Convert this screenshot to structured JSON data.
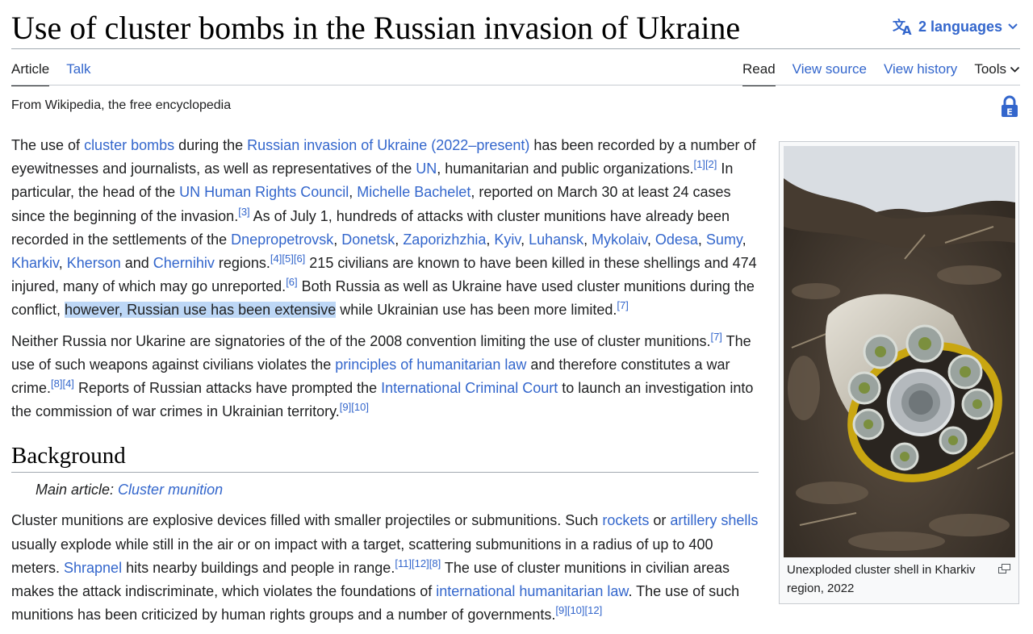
{
  "page": {
    "title": "Use of cluster bombs in the Russian invasion of Ukraine",
    "languages_label": "2 languages",
    "tagline": "From Wikipedia, the free encyclopedia"
  },
  "tabs": {
    "article": "Article",
    "talk": "Talk",
    "read": "Read",
    "view_source": "View source",
    "view_history": "View history",
    "tools": "Tools"
  },
  "intro": {
    "p1": [
      "The use of ",
      "cluster bombs",
      " during the ",
      "Russian invasion of Ukraine (2022–present)",
      " has been recorded by a number of eyewitnesses and journalists, as well as representatives of the ",
      "UN",
      ", humanitarian and public organizations.",
      "[1]",
      "[2]",
      " In particular, the head of the ",
      "UN Human Rights Council",
      ", ",
      "Michelle Bachelet",
      ", reported on March 30 at least 24 cases since the beginning of the invasion.",
      "[3]",
      " As of July 1, hundreds of attacks with cluster munitions have already been recorded in the settlements of the ",
      "Dnepropetrovsk",
      ", ",
      "Donetsk",
      ", ",
      "Zaporizhzhia",
      ", ",
      "Kyiv",
      ", ",
      "Luhansk",
      ", ",
      "Mykolaiv",
      ", ",
      "Odesa",
      ", ",
      "Sumy",
      ", ",
      "Kharkiv",
      ", ",
      "Kherson",
      " and ",
      "Chernihiv",
      " regions.",
      "[4]",
      "[5]",
      "[6]",
      " 215 civilians are known to have been killed in these shellings and 474 injured, many of which may go unreported.",
      "[6]",
      " Both Russia as well as Ukraine have used cluster munitions during the conflict, ",
      "however, Russian use has been extensive",
      " while Ukrainian use has been more limited.",
      "[7]"
    ],
    "p2": [
      "Neither Russia nor Ukarine are signatories of the of the 2008 convention limiting the use of cluster munitions.",
      "[7]",
      " The use of such weapons against civilians violates the ",
      "principles of humanitarian law",
      " and therefore constitutes a war crime.",
      "[8]",
      "[4]",
      " Reports of Russian attacks have prompted the ",
      "International Criminal Court",
      " to launch an investigation into the commission of war crimes in Ukrainian territory.",
      "[9]",
      "[10]"
    ]
  },
  "background": {
    "heading": "Background",
    "hatnote_prefix": "Main article: ",
    "hatnote_link": "Cluster munition",
    "p1": [
      "Cluster munitions are explosive devices filled with smaller projectiles or submunitions. Such ",
      "rockets",
      " or ",
      "artillery shells",
      " usually explode while still in the air or on impact with a target, scattering submunitions in a radius of up to 400 meters. ",
      "Shrapnel",
      " hits nearby buildings and people in range.",
      "[11]",
      "[12]",
      "[8]",
      " The use of cluster munitions in civilian areas makes the attack indiscriminate, which violates the foundations of ",
      "international humanitarian law",
      ". The use of such munitions has been criticized by human rights groups and a number of governments.",
      "[9]",
      "[10]",
      "[12]"
    ]
  },
  "infobox": {
    "caption": "Unexploded cluster shell in Kharkiv region, 2022"
  },
  "colors": {
    "link": "#3366cc",
    "text": "#202122",
    "highlight": "#bdd7f6",
    "shell": "#c9a611"
  },
  "icons": [
    "translate-icon",
    "chevron-down-icon",
    "lock-icon",
    "enlarge-icon"
  ]
}
